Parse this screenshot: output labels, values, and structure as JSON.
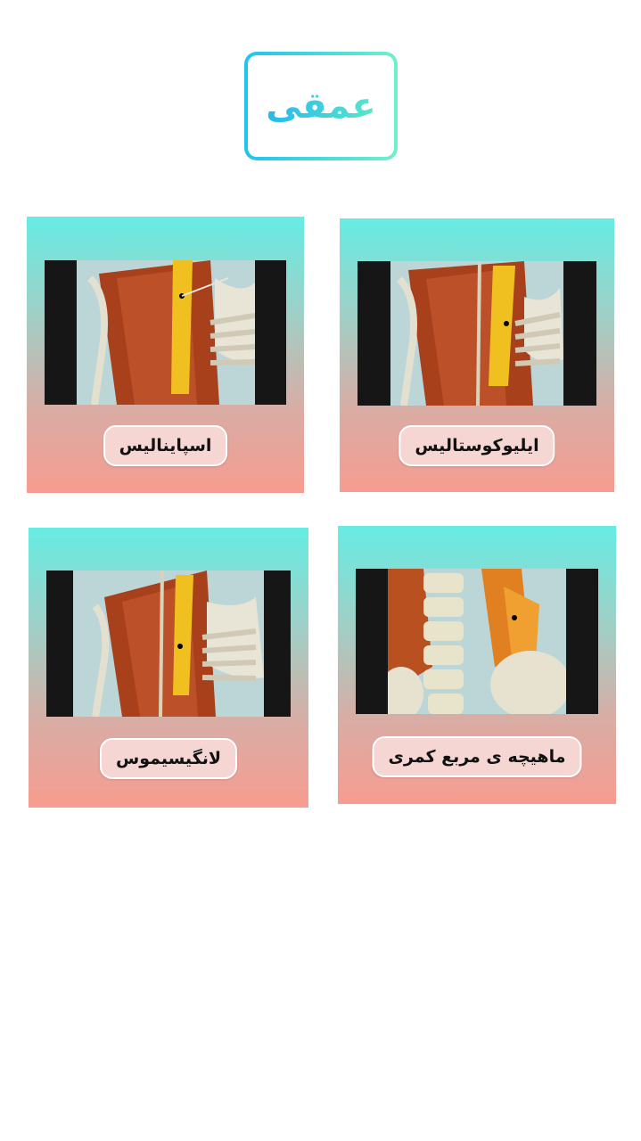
{
  "header": {
    "title": "عمقی"
  },
  "cards": [
    {
      "label": "ایلیوکوستالیس",
      "image_icon": "iliocostalis-muscle-image"
    },
    {
      "label": "اسپاینالیس",
      "image_icon": "spinalis-muscle-image"
    },
    {
      "label": "ماهیچه ی مربع کمری",
      "image_icon": "quadratus-lumborum-muscle-image"
    },
    {
      "label": "لانگیسیموس",
      "image_icon": "longissimus-muscle-image"
    }
  ],
  "colors": {
    "title_gradient_start": "#1ec3f0",
    "title_gradient_end": "#6ff0c8",
    "card_top": "#66ece3",
    "card_bottom": "#f79c90",
    "label_bg": "#f5d6d2"
  }
}
